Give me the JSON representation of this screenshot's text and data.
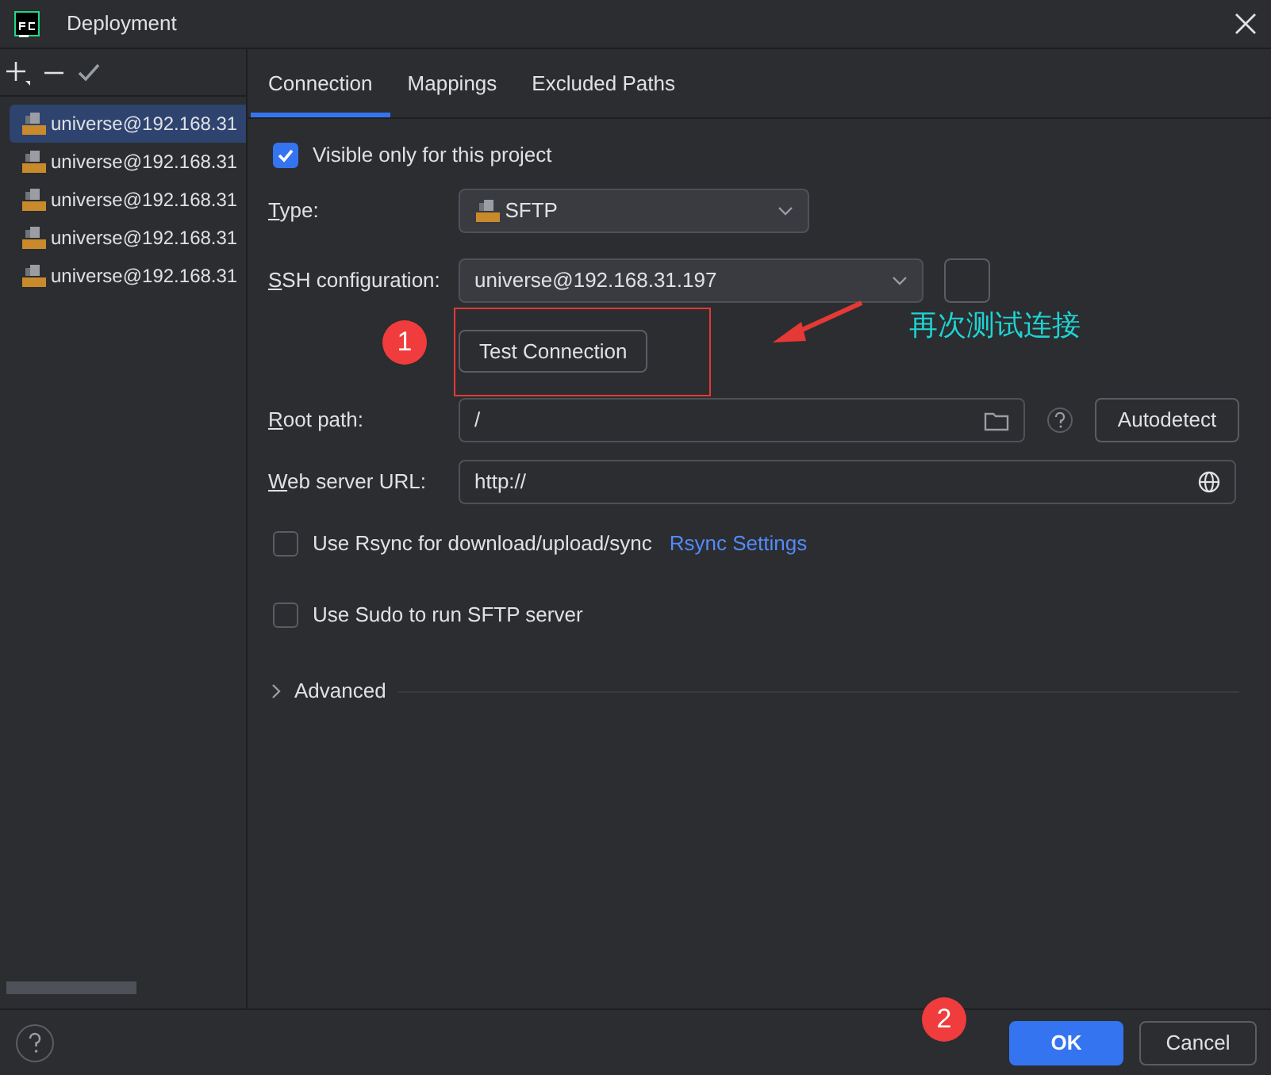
{
  "window": {
    "title": "Deployment"
  },
  "sidebar": {
    "items": [
      {
        "label": "universe@192.168.31",
        "selected": true
      },
      {
        "label": "universe@192.168.31",
        "selected": false
      },
      {
        "label": "universe@192.168.31",
        "selected": false
      },
      {
        "label": "universe@192.168.31",
        "selected": false
      },
      {
        "label": "universe@192.168.31",
        "selected": false
      }
    ]
  },
  "tabs": [
    {
      "label": "Connection",
      "selected": true
    },
    {
      "label": "Mappings",
      "selected": false
    },
    {
      "label": "Excluded Paths",
      "selected": false
    }
  ],
  "form": {
    "visible_only": {
      "label": "Visible only for this project",
      "checked": true
    },
    "type": {
      "label": "Type:",
      "value": "SFTP"
    },
    "ssh": {
      "label": "SSH configuration:",
      "value": "universe@192.168.31.197"
    },
    "test_button": "Test Connection",
    "root_path": {
      "label": "Root path:",
      "value": "/"
    },
    "autodetect": "Autodetect",
    "web_url": {
      "label": "Web server URL:",
      "value": "http://"
    },
    "rsync": {
      "label": "Use Rsync for download/upload/sync",
      "checked": false,
      "link": "Rsync Settings"
    },
    "sudo": {
      "label": "Use Sudo to run SFTP server",
      "checked": false
    },
    "advanced": {
      "label": "Advanced",
      "expanded": false
    }
  },
  "footer": {
    "ok": "OK",
    "cancel": "Cancel"
  },
  "annotations": [
    {
      "kind": "badge",
      "text": "1"
    },
    {
      "kind": "badge",
      "text": "2"
    },
    {
      "kind": "note",
      "text": "再次测试连接"
    }
  ]
}
